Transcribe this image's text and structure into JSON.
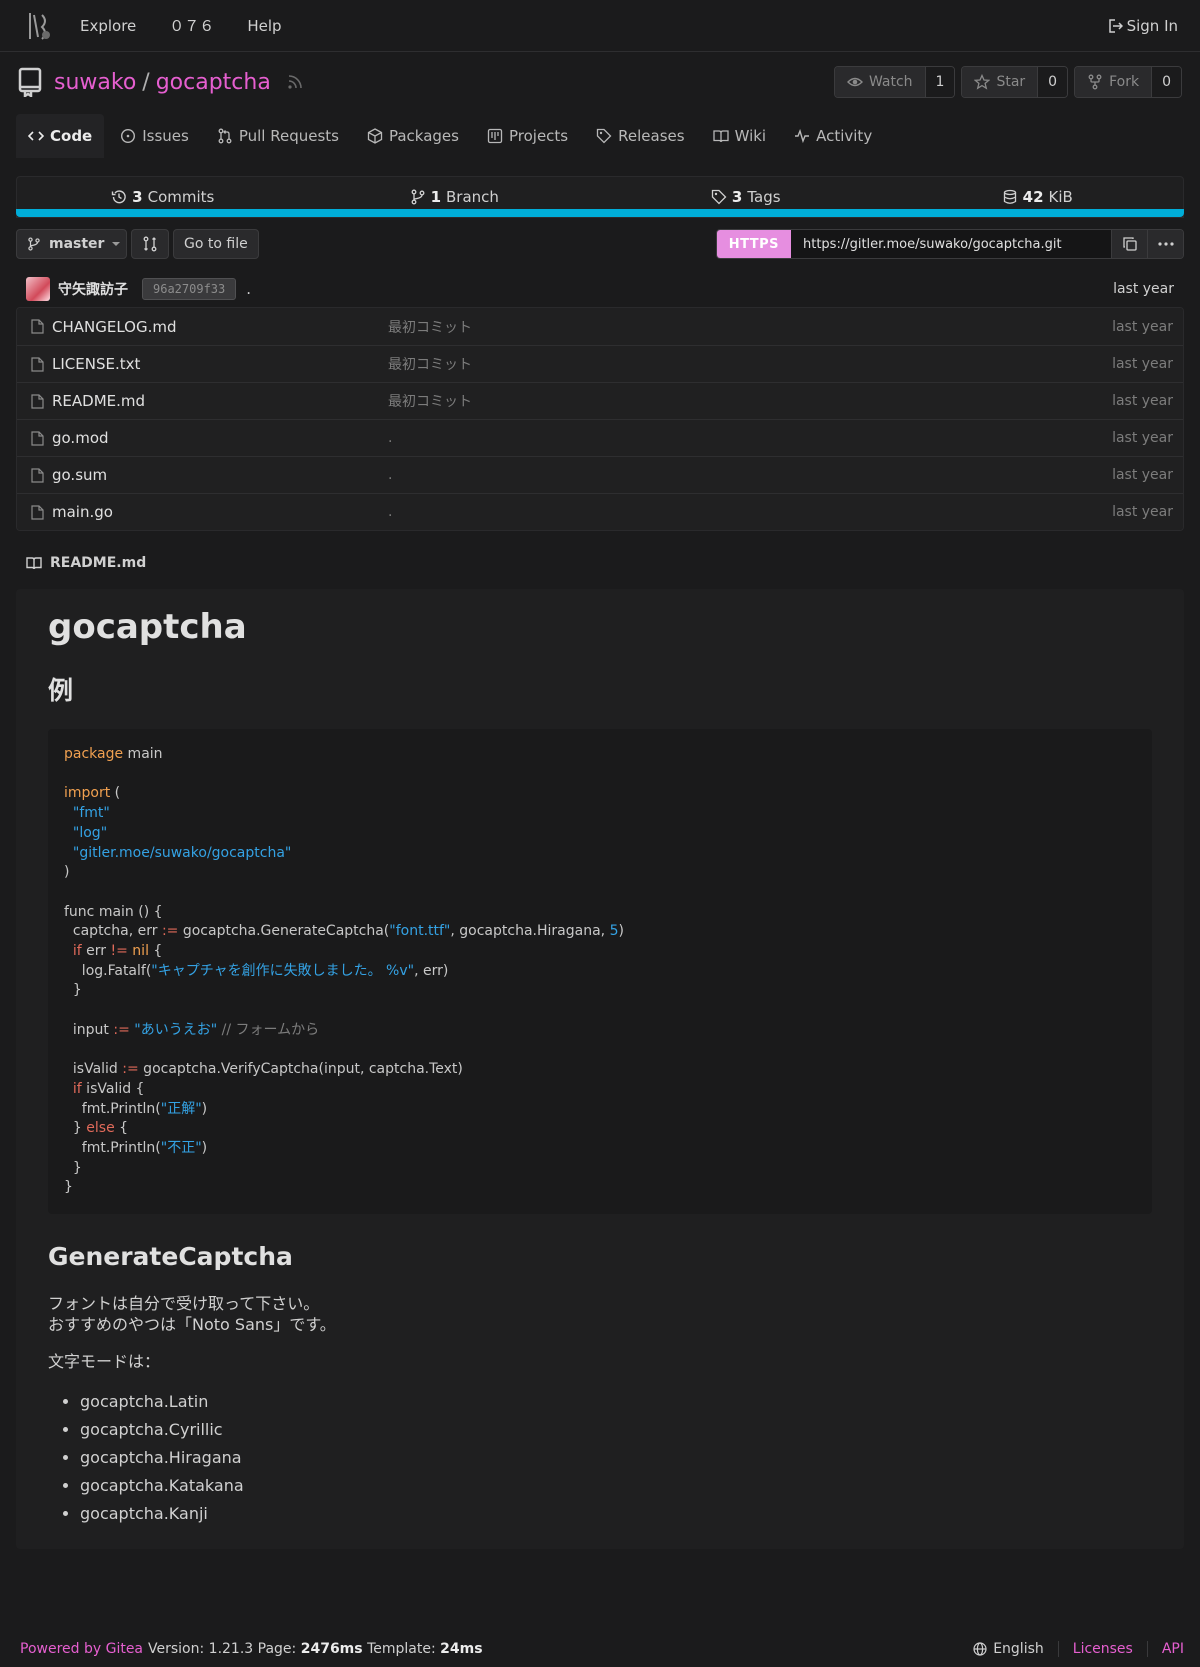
{
  "nav": {
    "explore": "Explore",
    "user_link": "０７６",
    "help": "Help",
    "sign_in": "Sign In"
  },
  "repo": {
    "owner": "suwako",
    "separator": "/",
    "name": "gocaptcha",
    "watch_label": "Watch",
    "watch_count": "1",
    "star_label": "Star",
    "star_count": "0",
    "fork_label": "Fork",
    "fork_count": "0"
  },
  "tabs": [
    {
      "label": "Code",
      "icon": "code-icon"
    },
    {
      "label": "Issues",
      "icon": "issue-icon"
    },
    {
      "label": "Pull Requests",
      "icon": "pull-request-icon"
    },
    {
      "label": "Packages",
      "icon": "package-icon"
    },
    {
      "label": "Projects",
      "icon": "project-icon"
    },
    {
      "label": "Releases",
      "icon": "tag-icon"
    },
    {
      "label": "Wiki",
      "icon": "book-icon"
    },
    {
      "label": "Activity",
      "icon": "pulse-icon"
    }
  ],
  "stats": {
    "commits_count": "3",
    "commits_label": "Commits",
    "branch_count": "1",
    "branch_label": "Branch",
    "tags_count": "3",
    "tags_label": "Tags",
    "size_value": "42",
    "size_unit": "KiB",
    "language_color": "#00add8"
  },
  "toolbar": {
    "branch": "master",
    "go_to_file": "Go to file",
    "clone_protocol": "HTTPS",
    "clone_url": "https://gitler.moe/suwako/gocaptcha.git"
  },
  "latest_commit": {
    "author": "守矢諏訪子",
    "sha": "96a2709f33",
    "message": ".",
    "time": "last year"
  },
  "files": [
    {
      "name": "CHANGELOG.md",
      "message": "最初コミット",
      "time": "last year"
    },
    {
      "name": "LICENSE.txt",
      "message": "最初コミット",
      "time": "last year"
    },
    {
      "name": "README.md",
      "message": "最初コミット",
      "time": "last year"
    },
    {
      "name": "go.mod",
      "message": ".",
      "time": "last year"
    },
    {
      "name": "go.sum",
      "message": ".",
      "time": "last year"
    },
    {
      "name": "main.go",
      "message": ".",
      "time": "last year"
    }
  ],
  "readme": {
    "filename": "README.md",
    "h1": "gocaptcha",
    "h2_example": "例",
    "code": {
      "package_kw": "package",
      "package_name": " main",
      "import_kw": "import",
      "import_open": " (",
      "imp1": "\"fmt\"",
      "imp2": "\"log\"",
      "imp3": "\"gitler.moe/suwako/gocaptcha\"",
      "import_close": ")",
      "func_sig": "func main () {",
      "l1a": "  captcha, err ",
      "l1op": ":=",
      "l1b": " gocaptcha.GenerateCaptcha(",
      "l1s": "\"font.ttf\"",
      "l1c": ", gocaptcha.Hiragana, ",
      "l1n": "5",
      "l1d": ")",
      "l2kw": "if",
      "l2a": " err ",
      "l2op": "!=",
      "l2nil": " nil",
      "l2b": " {",
      "l3a": "    log.Fatalf(",
      "l3s": "\"キャプチャを創作に失敗しました。 %v\"",
      "l3b": ", err)",
      "l4": "  }",
      "l5a": "  input ",
      "l5op": ":=",
      "l5s": " \"あいうえお\"",
      "l5c": " // フォームから",
      "l6a": "  isValid ",
      "l6op": ":=",
      "l6b": " gocaptcha.VerifyCaptcha(input, captcha.Text)",
      "l7kw": "if",
      "l7b": " isValid {",
      "l8a": "    fmt.Println(",
      "l8s": "\"正解\"",
      "l8b": ")",
      "l9a": "  } ",
      "l9kw": "else",
      "l9b": " {",
      "l10a": "    fmt.Println(",
      "l10s": "\"不正\"",
      "l10b": ")",
      "l11": "  }",
      "l12": "}"
    },
    "h2_generate": "GenerateCaptcha",
    "p1_line1": "フォントは自分で受け取って下さい。",
    "p1_line2": "おすすめのやつは「Noto Sans」です。",
    "p2": "文字モードは：",
    "modes": [
      "gocaptcha.Latin",
      "gocaptcha.Cyrillic",
      "gocaptcha.Hiragana",
      "gocaptcha.Katakana",
      "gocaptcha.Kanji"
    ]
  },
  "footer": {
    "powered": "Powered by Gitea",
    "version_label": "Version:",
    "version": "1.21.3",
    "page_label": "Page:",
    "page_time": "2476ms",
    "template_label": "Template:",
    "template_time": "24ms",
    "language": "English",
    "licenses": "Licenses",
    "api": "API"
  }
}
